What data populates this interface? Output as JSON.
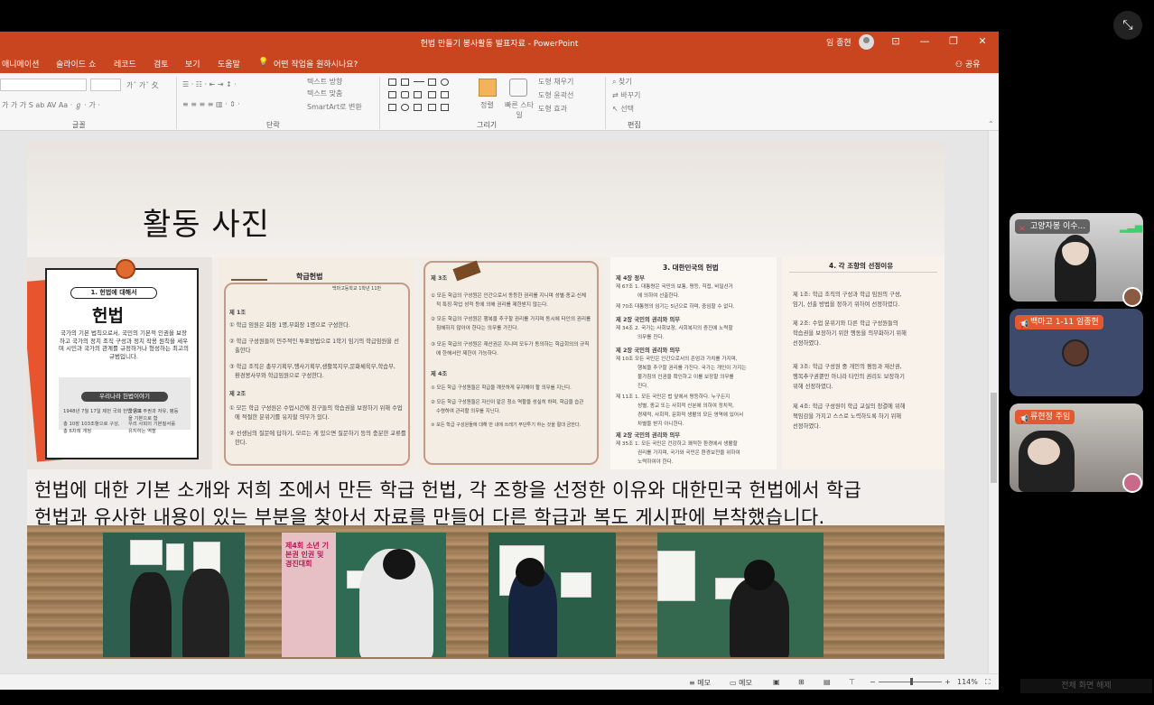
{
  "window": {
    "title": "헌법 만들기 봉사활동 발표자료 - PowerPoint",
    "user": "임 종현",
    "controls": [
      "⊡",
      "—",
      "❐",
      "✕"
    ]
  },
  "tabs": [
    "애니메이션",
    "슬라이드 쇼",
    "레코드",
    "검토",
    "보기",
    "도움말"
  ],
  "tell_me": "어떤 작업을 원하시나요?",
  "share": "공유",
  "ribbon": {
    "groups": {
      "font": "글꼴",
      "paragraph": "단락",
      "drawing": "그리기",
      "editing": "편집"
    },
    "text_direction": "텍스트 방향",
    "align_text": "텍스트 맞춤",
    "smartart": "SmartArt로 변환",
    "arrange": "정렬",
    "quick_styles": "빠른 스타일",
    "shape_fill": "도형 채우기",
    "shape_outline": "도형 윤곽선",
    "shape_effects": "도형 효과",
    "find": "찾기",
    "replace": "바꾸기",
    "select": "선택"
  },
  "slide": {
    "title": "활동 사진",
    "caption_line1": "헌법에 대한 기본 소개와 저희 조에서 만든 학급 헌법, 각 조항을 선정한 이유와 대한민국 헌법에서 학급",
    "caption_line2": "헌법과 유사한 내용이 있는 부분을 찾아서 자료를 만들어 다른 학급과 복도 게시판에 부착했습니다."
  },
  "card1": {
    "pill": "1. 헌법에 대해서",
    "big": "헌법",
    "body": "국가의 기본 법칙으로서, 국민의 기본적 인권을 보장하고 국가의 정치 조직 구성과 정치 작용 원칙을 세우며 시민과 국가의 관계를 규정하거나 형성하는 최고의 규범입니다.",
    "subhead": "우리나라 헌법이야기",
    "items": [
      "1948년 7월 17일 제헌 국회 헌법 공포",
      "국민의 주권과 자유, 평등을 기본으로 함",
      "총 10장 103조항으로 구성, 총 6차례 개정",
      "우리 사회의 기본질서를 유지하는 역할"
    ]
  },
  "card2": {
    "title": "학급헌법",
    "school": "백마고등학교 1학년 11반",
    "lines": [
      "제 1조",
      "① 학급 임원은 회장 1명,부회장 1명으로 구성한다.",
      "② 학급 구성원들이 민주적인 투표방법으로 1학기 임기의 학급임원을 선",
      "출한다",
      "③ 학급 조직은 총무기획부,행사기획부,생활복지부,문화체육부,학습부,",
      "환경봉사부와 학급임원으로 구성한다.",
      "제 2조",
      "① 모든 학급 구성원은 수업시간에 친구들의 학습권을 보장하기 위해 수업",
      "에 적절한 분위기를 유지할 의무가 있다.",
      "② 선생님의 질문에 답하기, 모르는 게 있으면 질문하기 등의 충분한 교류를",
      "한다."
    ]
  },
  "card3": {
    "lines": [
      "제 3조",
      "① 모든 학급의 구성원은 인간으로서 동등한 권리를 지니며 성별·종교·신체",
      "적 특징·학업 성적 등에 의해 권리를 제한받지 않는다.",
      "② 모든 학급의 구성원은 행복을 추구할 권리를 가지며 동시에 타인의 권리를",
      "침해하지 않아야 한다는 의무를 가진다.",
      "③ 모든 학급의 구성원은 재산권은 지니며 모두가 동의하는 학급회의의 규칙",
      "에 한해서만 제한이 가능하다.",
      "제 4조",
      "① 모든 학급 구성원들은 학급을 깨끗하게 유지해야 할 의무를 지닌다.",
      "② 모든 학급 구성원들은 자신이 맡은 청소 역할을 성실히 하며, 학급을 습관",
      "수령하여 관리할 의무를 지닌다.",
      "③ 모든 학급 구성원들에 대해 반 내에 쓰레기 무단투기 하는 것을 절대 금한다."
    ]
  },
  "card4": {
    "title": "3. 대한민국의 헌법",
    "lines": [
      "제 4장 정부",
      "제 67조  1. 대통령은 국민의 보통, 평등, 직접, 비밀선거",
      "에 의하여 선출한다.",
      "제 70조  대통령의 임기는 5년으로 하며, 중임할 수 없다.",
      "제 2장 국민의 권리와 의무",
      "제 34조  2. 국가는 사회보장, 사회복지의 증진에 노력할",
      "의무를 진다.",
      "제 2장 국민의 권리와 의무",
      "제 10조  모든 국민은 인간으로서의 존엄과 가치를 가지며,",
      "행복을 추구할 권리를 가진다. 국가는 개인이 가지는",
      "불가침의 인권을 확인하고 이를 보장할 의무를",
      "진다.",
      "제 11조  1. 모든 국민은 법 앞에서 평등하다. 누구든지",
      "성별, 종교 또는 사회적 신분에 의하여 정치적,",
      "경제적, 사회적, 문화적 생활의 모든 영역에 있어서",
      "차별을 받지 아니한다.",
      "제 2장 국민의 권리와 의무",
      "제 35조  1. 모든 국민은 건강하고 쾌적한 환경에서 생활할",
      "권리를 가지며, 국가와 국민은 환경보전을 위하여",
      "노력하여야 한다."
    ]
  },
  "card5": {
    "title": "4. 각 조항의 선정이유",
    "lines": [
      "제 1조: 학급 조직의 구성과 학급 임원의 구성,",
      "임기, 선출 방법을 정하기 위하여 선정하였다.",
      "",
      "제 2조: 수업 분위기와 다른 학급 구성원들의",
      "학습권을 보장하기 위한 행동을 의무화하기 위해",
      "선정하였다.",
      "",
      "제 3조: 학급 구성원 중 개인의 평등과 재산권,",
      "행복추구권뿐만 아니라 타인의 권리도 보장하기",
      "위해 선정하였다.",
      "",
      "제 4조: 학급 구성원이 학급 교실의 청결에 위해",
      "책임감을 가지고 스스로 노력하도록 하기 위해",
      "선정하였다."
    ]
  },
  "poster_text": {
    "p2": "제4회 소년 기본권 인권 및 경진대회"
  },
  "status": {
    "notes": "메모",
    "notes2": "메모",
    "zoom": "114%"
  },
  "participants": [
    {
      "name": "고양자봉 이수...",
      "muted": true
    },
    {
      "name": "백마고 1-11 임종현",
      "muted": false
    },
    {
      "name": "류현정 주임",
      "muted": false
    }
  ],
  "bottom_text": "전체 화면 해제"
}
